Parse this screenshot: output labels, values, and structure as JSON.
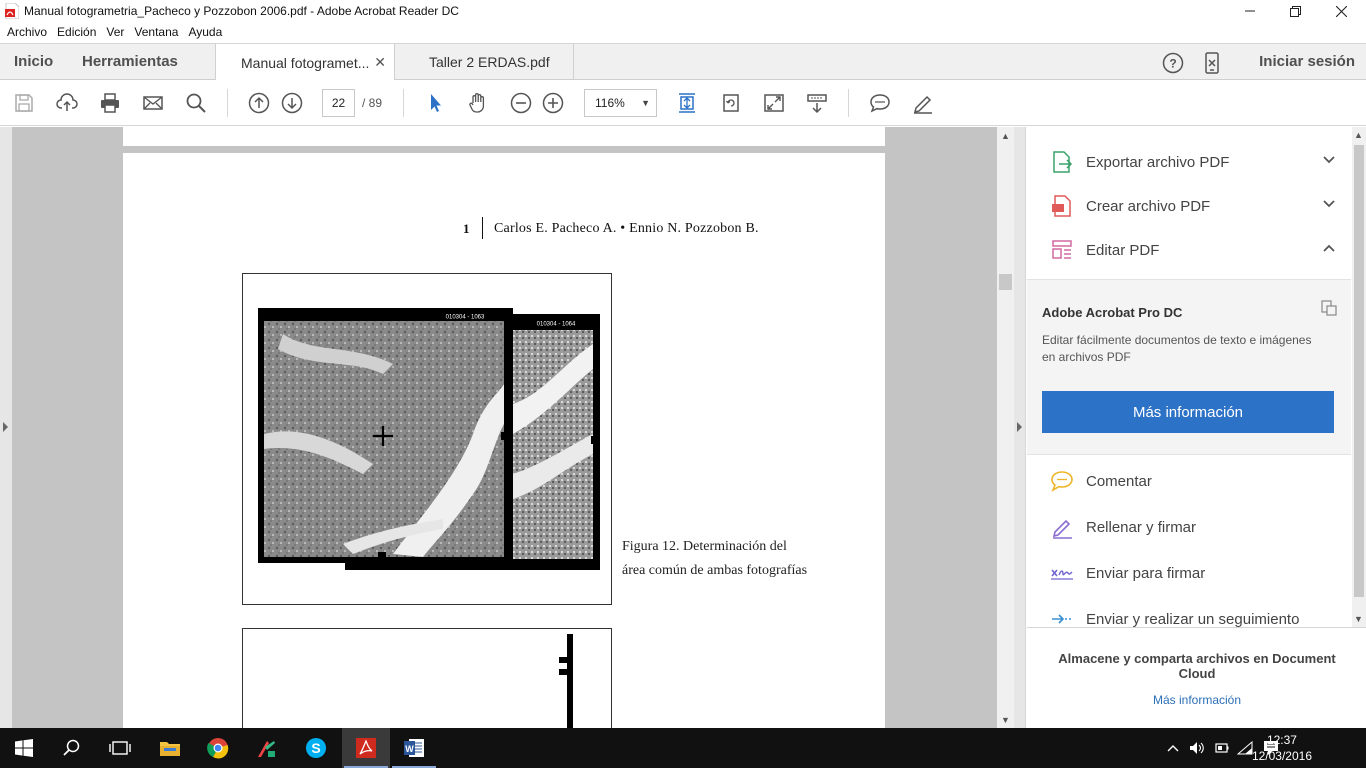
{
  "window": {
    "title": "Manual fotogrametria_Pacheco y Pozzobon 2006.pdf - Adobe Acrobat Reader DC",
    "controls": [
      "minimize",
      "maximize",
      "close"
    ]
  },
  "menubar": {
    "items": [
      "Archivo",
      "Edición",
      "Ver",
      "Ventana",
      "Ayuda"
    ]
  },
  "tabs": {
    "home": "Inicio",
    "tools": "Herramientas",
    "documents": [
      {
        "label": "Manual fotogramet...",
        "active": true
      },
      {
        "label": "Taller 2 ERDAS.pdf",
        "active": false
      }
    ],
    "signin": "Iniciar sesión"
  },
  "toolbar": {
    "page_current": "22",
    "page_total": "/  89",
    "zoom": "116%",
    "icons": [
      "save-icon",
      "upload-icon",
      "print-icon",
      "email-icon",
      "search-icon",
      "page-up-icon",
      "page-down-icon",
      "zoom-out-icon",
      "zoom-in-icon",
      "select-cursor-icon",
      "hand-icon",
      "fit-page-icon",
      "rotate-icon",
      "fullscreen-icon",
      "scroll-mode-icon",
      "comment-icon",
      "sign-icon"
    ]
  },
  "document": {
    "header_page_number": "1",
    "header_authors": "Carlos E. Pacheco A. • Ennio N. Pozzobon B.",
    "figure_caption": "Figura 12. Determinación del área común de ambas fotografías",
    "photo_label_left": "010304 - 1063",
    "photo_label_right": "010304 - 1064"
  },
  "right_pane": {
    "tools": [
      {
        "label": "Exportar archivo PDF",
        "icon": "export-pdf-icon",
        "expanded": false
      },
      {
        "label": "Crear archivo PDF",
        "icon": "create-pdf-icon",
        "expanded": false
      },
      {
        "label": "Editar PDF",
        "icon": "edit-pdf-icon",
        "expanded": true
      }
    ],
    "promo": {
      "title": "Adobe Acrobat Pro DC",
      "description": "Editar fácilmente documentos de texto e imágenes en archivos PDF",
      "button": "Más información"
    },
    "more_tools": [
      {
        "label": "Comentar",
        "icon": "comment-icon"
      },
      {
        "label": "Rellenar y firmar",
        "icon": "fill-sign-icon"
      },
      {
        "label": "Enviar para firmar",
        "icon": "send-sign-icon"
      },
      {
        "label": "Enviar y realizar un seguimiento",
        "icon": "send-track-icon"
      }
    ],
    "footer": {
      "title": "Almacene y comparta archivos en Document Cloud",
      "link": "Más información"
    }
  },
  "taskbar": {
    "apps": [
      "start",
      "search",
      "task-view",
      "file-explorer",
      "chrome",
      "arcgis",
      "skype",
      "acrobat-reader",
      "word"
    ],
    "time": "12:37",
    "date": "12/03/2016"
  },
  "colors": {
    "accent_blue": "#2c72c7",
    "link_blue": "#2c6fb7",
    "doc_background": "#c4c4c4"
  }
}
